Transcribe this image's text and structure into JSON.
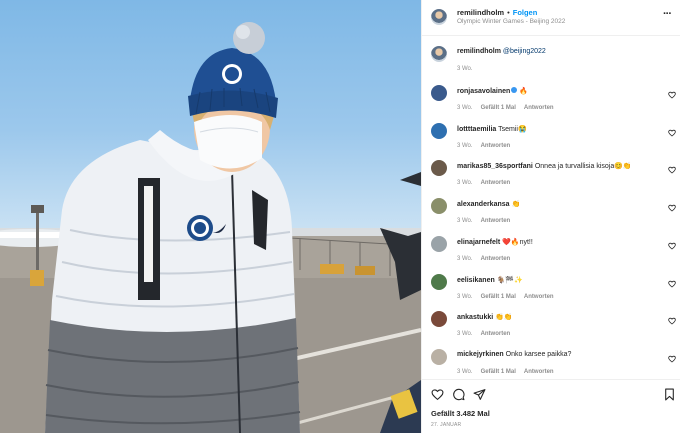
{
  "post": {
    "owner": "remilindholm",
    "follow_label": "Folgen",
    "separator": "•",
    "location": "Olympic Winter Games - Beijing 2022",
    "caption_user": "remilindholm",
    "caption_mention": "@beijing2022",
    "caption_time": "3 Wo.",
    "likes": "Gefällt 3.482 Mal",
    "date": "27. JANUAR"
  },
  "comments": [
    {
      "user": "ronjasavolainen",
      "verified": true,
      "text": "🔥",
      "time": "3 Wo.",
      "likes": "Gefällt 1 Mal",
      "reply": "Antworten",
      "avatar_color": "#3a5a8c"
    },
    {
      "user": "lottttaemilia",
      "verified": false,
      "text": "Tsemii😭",
      "time": "3 Wo.",
      "likes": "",
      "reply": "Antworten",
      "avatar_color": "#2e6fb0"
    },
    {
      "user": "marikas85_36sportfani",
      "verified": false,
      "text": "Onnea ja turvallisia kisoja😊👏",
      "time": "3 Wo.",
      "likes": "",
      "reply": "Antworten",
      "avatar_color": "#6b5a4a"
    },
    {
      "user": "alexanderkansa",
      "verified": false,
      "text": "👏",
      "time": "3 Wo.",
      "likes": "",
      "reply": "Antworten",
      "avatar_color": "#8a8f6a"
    },
    {
      "user": "elinajarnefelt",
      "verified": false,
      "text": "❤️🔥nyt!!",
      "time": "3 Wo.",
      "likes": "",
      "reply": "Antworten",
      "avatar_color": "#9aa3a8"
    },
    {
      "user": "eelisikanen",
      "verified": false,
      "text": "🐐🏁✨",
      "time": "3 Wo.",
      "likes": "Gefällt 1 Mal",
      "reply": "Antworten",
      "avatar_color": "#4f7a4a"
    },
    {
      "user": "ankastukki",
      "verified": false,
      "text": "👏👏",
      "time": "3 Wo.",
      "likes": "",
      "reply": "Antworten",
      "avatar_color": "#7a4a3a"
    },
    {
      "user": "mickejyrkinen",
      "verified": false,
      "text": "Onko karsee paikka?",
      "time": "3 Wo.",
      "likes": "Gefällt 1 Mal",
      "reply": "Antworten",
      "avatar_color": "#b9b0a4"
    }
  ],
  "icons": {
    "more": "more-options-icon",
    "like": "heart-icon",
    "comment": "comment-icon",
    "share": "share-icon",
    "save": "bookmark-icon"
  }
}
